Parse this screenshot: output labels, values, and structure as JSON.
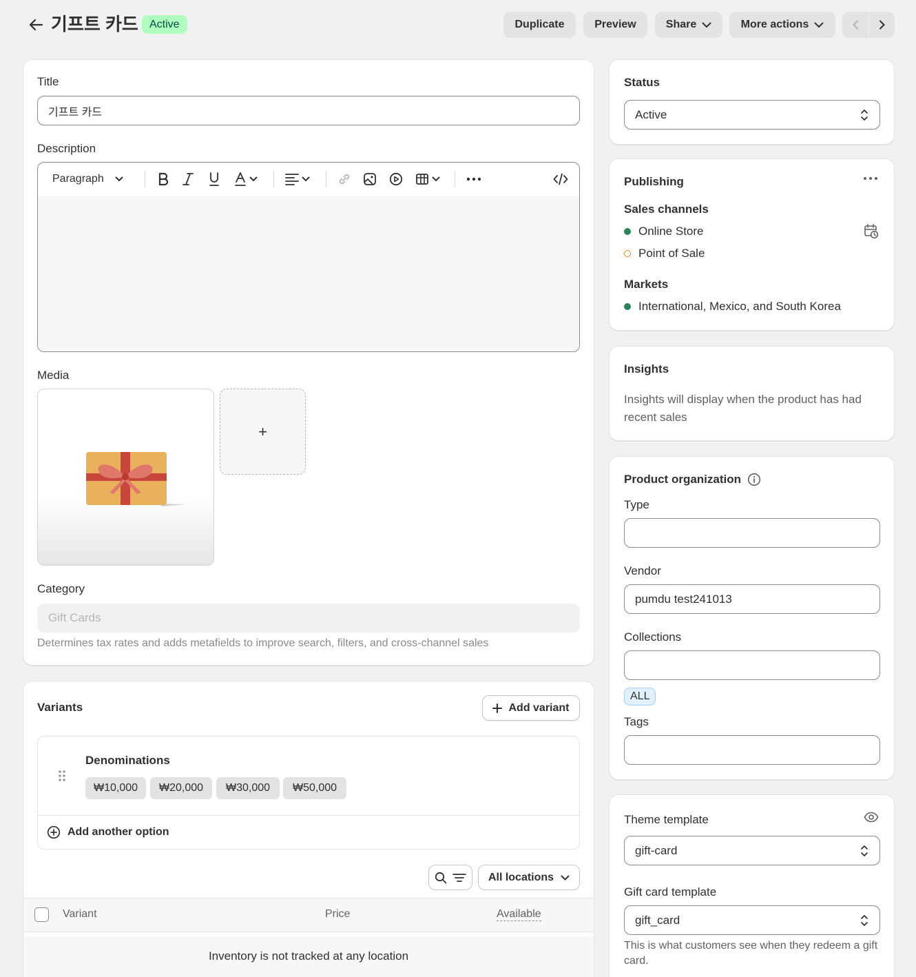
{
  "header": {
    "title": "기프트 카드",
    "status_badge": "Active",
    "duplicate_label": "Duplicate",
    "preview_label": "Preview",
    "share_label": "Share",
    "more_actions_label": "More actions"
  },
  "main": {
    "title_label": "Title",
    "title_value": "기프트 카드",
    "description_label": "Description",
    "editor": {
      "paragraph_label": "Paragraph"
    },
    "media_label": "Media",
    "add_media_symbol": "+",
    "category_label": "Category",
    "category_placeholder": "Gift Cards",
    "category_help": "Determines tax rates and adds metafields to improve search, filters, and cross-channel sales"
  },
  "variants": {
    "heading": "Variants",
    "add_variant_label": "Add variant",
    "option_name": "Denominations",
    "option_values": [
      "₩10,000",
      "₩20,000",
      "₩30,000",
      "₩50,000"
    ],
    "add_option_label": "Add another option",
    "locations_label": "All locations",
    "columns": {
      "variant": "Variant",
      "price": "Price",
      "available": "Available"
    },
    "empty_message": "Inventory is not tracked at any location"
  },
  "sidebar": {
    "status": {
      "heading": "Status",
      "value": "Active"
    },
    "publishing": {
      "heading": "Publishing",
      "sales_channels_label": "Sales channels",
      "channels": [
        {
          "name": "Online Store",
          "state": "active",
          "color": "#29845a"
        },
        {
          "name": "Point of Sale",
          "state": "inactive",
          "color": "#e08b1c"
        }
      ],
      "markets_label": "Markets",
      "markets_value": "International, Mexico, and South Korea"
    },
    "insights": {
      "heading": "Insights",
      "text": "Insights will display when the product has had recent sales"
    },
    "organization": {
      "heading": "Product organization",
      "type_label": "Type",
      "type_value": "",
      "vendor_label": "Vendor",
      "vendor_value": "pumdu test241013",
      "collections_label": "Collections",
      "collections_value": "",
      "collection_tag": "ALL",
      "tags_label": "Tags",
      "tags_value": ""
    },
    "templates": {
      "theme_label": "Theme template",
      "theme_value": "gift-card",
      "gift_label": "Gift card template",
      "gift_value": "gift_card",
      "gift_help": "This is what customers see when they redeem a gift card."
    }
  },
  "colors": {
    "page_bg": "#f1f1f1",
    "badge_bg": "#affebf",
    "badge_text": "#014b40",
    "active_dot": "#29845a",
    "inactive_dot": "#e08b1c",
    "tag_bg": "#e0f0ff"
  }
}
